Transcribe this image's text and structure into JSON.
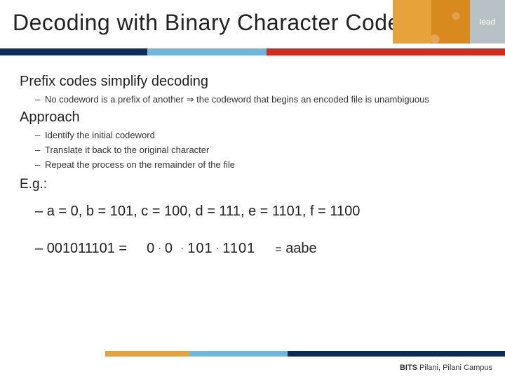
{
  "decor": {
    "lead": "lead"
  },
  "title": "Decoding with Binary Character Codes",
  "section1": {
    "heading": "Prefix codes simplify decoding",
    "bullet": "No codeword is a prefix of another ⇒ the codeword that begins an encoded file is unambiguous"
  },
  "section2": {
    "heading": "Approach",
    "bullets": [
      "Identify the initial codeword",
      "Translate it back to the original character",
      "Repeat the process on the remainder of the file"
    ]
  },
  "example": {
    "label": "E.g.:",
    "codes": "a = 0, b = 101, c = 100, d = 111, e = 1101, f = 1100",
    "encoded": "001011101 =",
    "split": [
      "0",
      "0",
      "101",
      "1101"
    ],
    "equals": "=",
    "decoded": "aabe"
  },
  "footer": {
    "org": "BITS",
    "rest": " Pilani, Pilani Campus"
  }
}
